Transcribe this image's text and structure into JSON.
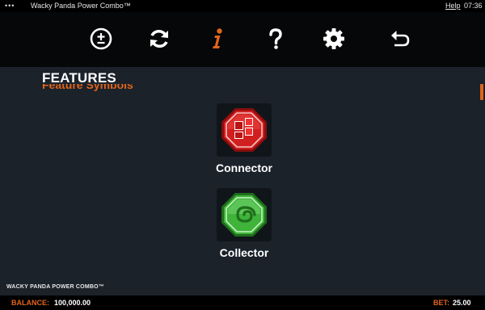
{
  "window": {
    "menu_dots": "•••",
    "title": "Wacky Panda Power Combo™",
    "help_label": "Help",
    "clock": "07:36"
  },
  "toolbar": {
    "items": [
      {
        "name": "bet-adjust",
        "icon": "plus-minus-icon"
      },
      {
        "name": "autoplay",
        "icon": "refresh-icon"
      },
      {
        "name": "info",
        "icon": "info-icon",
        "active": true
      },
      {
        "name": "help",
        "icon": "question-icon"
      },
      {
        "name": "settings",
        "icon": "gear-icon"
      },
      {
        "name": "back",
        "icon": "back-arrow-icon"
      }
    ]
  },
  "info_page": {
    "heading": "FEATURES",
    "subheading": "Feature Symbols",
    "symbols": [
      {
        "label": "Connector",
        "color": "#d11f1f"
      },
      {
        "label": "Collector",
        "color": "#3fb33a"
      }
    ]
  },
  "footer": {
    "game_logo": "WACKY PANDA POWER COMBO™",
    "balance_label": "BALANCE:",
    "balance_value": "100,000.00",
    "bet_label": "BET:",
    "bet_value": "25.00"
  },
  "colors": {
    "accent": "#e0651c",
    "background": "#1b222a",
    "toolbar": "#050708"
  }
}
